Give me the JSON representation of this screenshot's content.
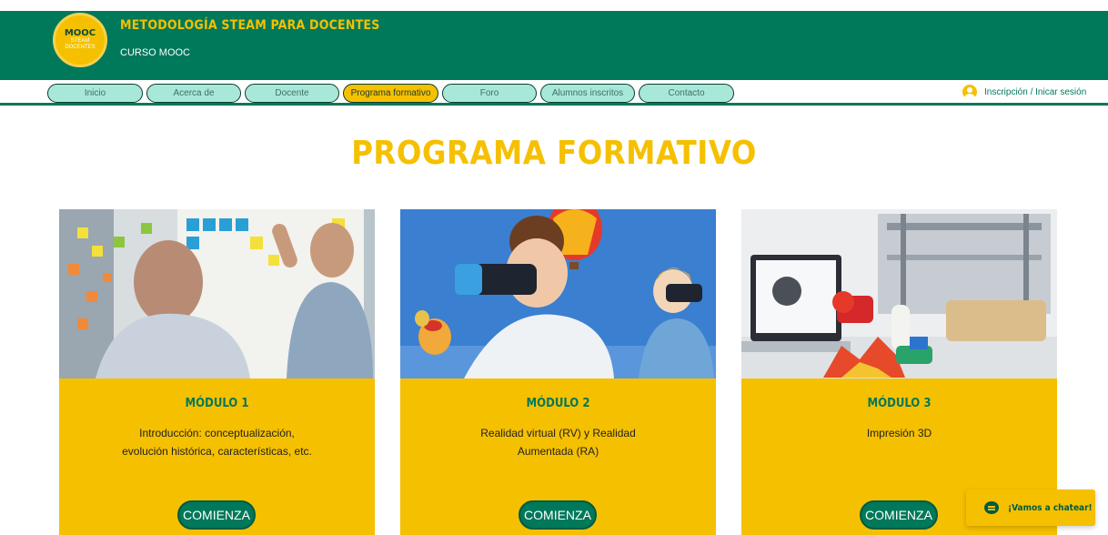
{
  "header": {
    "logo": {
      "line1": "MOOC",
      "line2": "STEAM",
      "line3": "DOCENTES"
    },
    "title": "METODOLOGÍA STEAM PARA DOCENTES",
    "subtitle": "CURSO MOOC"
  },
  "nav": {
    "items": [
      {
        "label": "Inicio"
      },
      {
        "label": "Acerca de"
      },
      {
        "label": "Docente"
      },
      {
        "label": "Programa formativo",
        "active": true
      },
      {
        "label": "Foro"
      },
      {
        "label": "Alumnos inscritos"
      },
      {
        "label": "Contacto"
      }
    ],
    "login_label": "Inscripción / Inicar sesión",
    "login_icon": "user-icon"
  },
  "main": {
    "title": "PROGRAMA FORMATIVO",
    "modules": [
      {
        "title": "MÓDULO 1",
        "description": "Introducción: conceptualización, evolución histórica, características, etc.",
        "button": "COMIENZA",
        "image": "team-whiteboard-photo"
      },
      {
        "title": "MÓDULO 2",
        "description": "Realidad virtual (RV) y Realidad Aumentada (RA)",
        "button": "COMIENZA",
        "image": "kids-vr-headsets-photo"
      },
      {
        "title": "MÓDULO 3",
        "description": "Impresión 3D",
        "button": "COMIENZA",
        "image": "3d-printer-laptop-photo"
      }
    ]
  },
  "chat": {
    "label": "¡Vamos a chatear!",
    "icon": "chat-bubble-icon"
  },
  "colors": {
    "brand_green": "#00785a",
    "brand_yellow": "#f5c000",
    "nav_pill": "#a8e8d8"
  }
}
